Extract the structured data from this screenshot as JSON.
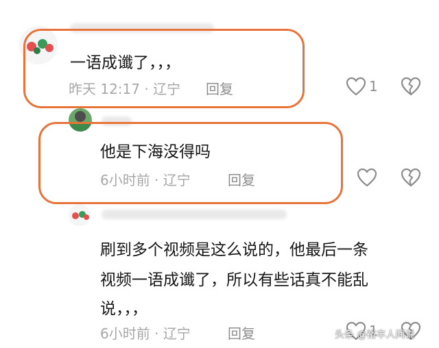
{
  "comments": [
    {
      "text": "一语成谶了，，，",
      "meta": "昨天 12:17 · 辽宁",
      "reply_label": "回复",
      "like_count": "1"
    },
    {
      "text": "他是下海没得吗",
      "meta": "6小时前 · 辽宁",
      "reply_label": "回复"
    },
    {
      "text_lines": [
        "刷到多个视频是这么说的，他最后一条",
        "视频一语成谶了，所以有些话真不能乱",
        "说，，，"
      ],
      "meta": "6小时前 · 辽宁",
      "reply_label": "回复",
      "like_count": "1"
    }
  ],
  "watermark": "头条 @裕丰人间说",
  "colors": {
    "highlight": "#e8733a",
    "meta": "#a7a7a7",
    "icon": "#8c8c8c"
  },
  "icons": [
    "heart-icon",
    "broken-heart-icon"
  ]
}
